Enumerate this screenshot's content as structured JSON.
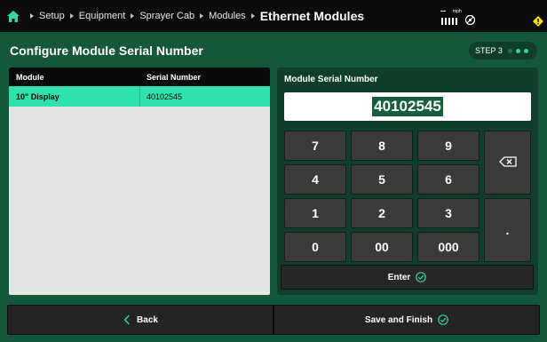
{
  "breadcrumb": {
    "items": [
      "Setup",
      "Equipment",
      "Sprayer Cab",
      "Modules"
    ],
    "current": "Ethernet Modules"
  },
  "status": {
    "speed_value": "--",
    "speed_unit": "mph"
  },
  "page": {
    "title": "Configure Module Serial Number",
    "step_label": "STEP 3",
    "step_total": 3,
    "step_current": 3
  },
  "table": {
    "headers": [
      "Module",
      "Serial Number"
    ],
    "rows": [
      {
        "module": "10\" Display",
        "serial": "40102545"
      }
    ]
  },
  "keypad": {
    "title": "Module Serial Number",
    "value": "40102545",
    "keys": [
      "7",
      "8",
      "9",
      "4",
      "5",
      "6",
      "1",
      "2",
      "3",
      "0",
      "00",
      "000",
      "."
    ],
    "enter_label": "Enter"
  },
  "footer": {
    "back_label": "Back",
    "finish_label": "Save and Finish"
  },
  "colors": {
    "background": "#14573a",
    "accent": "#2fe1ad",
    "topbar": "#0c0c0c"
  }
}
